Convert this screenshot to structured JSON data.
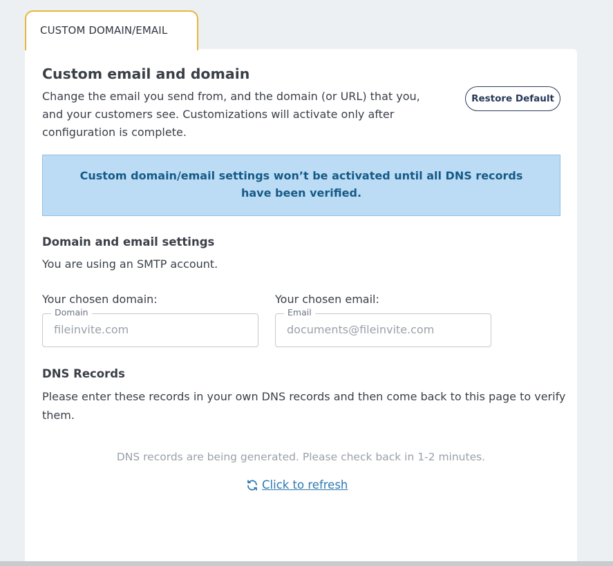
{
  "tab": {
    "label": "CUSTOM DOMAIN/EMAIL"
  },
  "header": {
    "title": "Custom email and domain",
    "description": "Change the email you send from, and the domain (or URL) that you, and your customers see. Customizations will activate only after configuration is complete.",
    "restore_label": "Restore Default"
  },
  "alert": {
    "text": "Custom domain/email settings won’t be activated until all DNS records have been verified."
  },
  "settings": {
    "heading": "Domain and email settings",
    "smtp_note": "You are using an SMTP account.",
    "domain": {
      "label": "Your chosen domain:",
      "legend": "Domain",
      "value": "fileinvite.com"
    },
    "email": {
      "label": "Your chosen email:",
      "legend": "Email",
      "value": "documents@fileinvite.com"
    }
  },
  "dns": {
    "heading": "DNS Records",
    "description": "Please enter these records in your own DNS records and then come back to this page to verify them.",
    "generating_note": "DNS records are being generated. Please check back in 1-2 minutes.",
    "refresh_label": "Click to refresh",
    "refresh_icon": "refresh-icon"
  },
  "colors": {
    "tab_border": "#e7b53a",
    "alert_bg": "#bcdcf5",
    "alert_text": "#155a86",
    "link": "#2c78b0",
    "button_border": "#2a3d5b"
  }
}
